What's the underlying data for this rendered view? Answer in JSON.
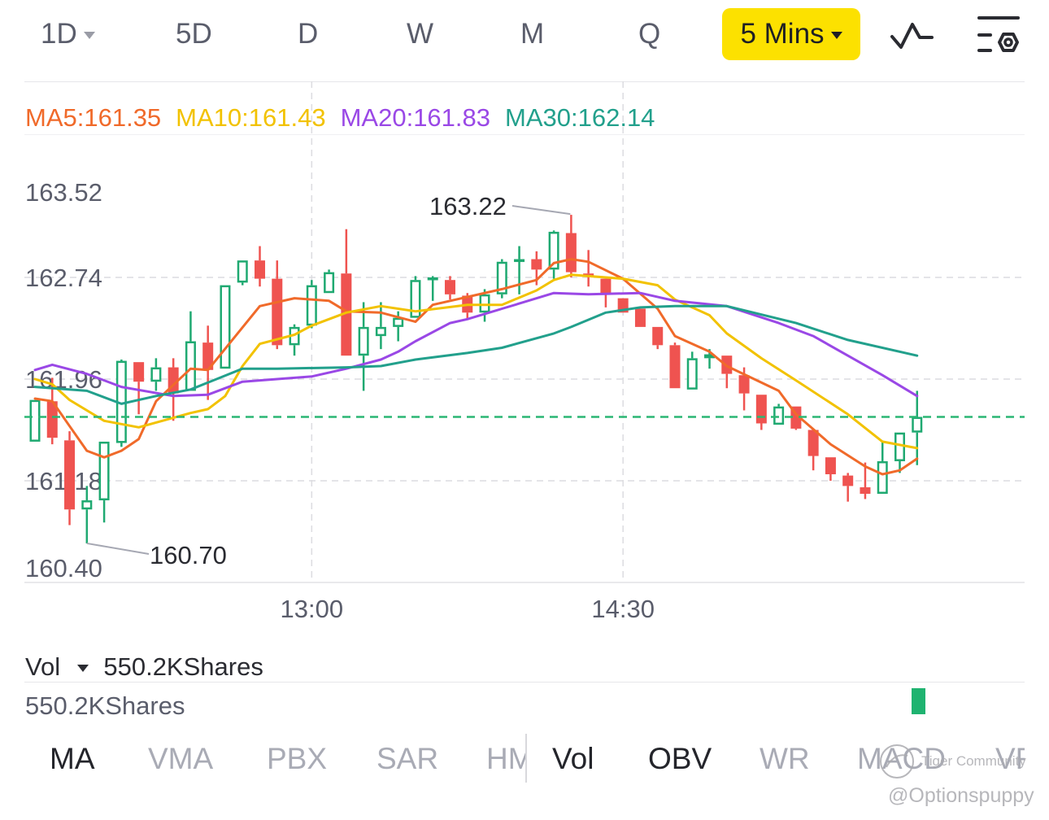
{
  "periods": [
    {
      "label": "1D",
      "dropdown": true
    },
    {
      "label": "5D"
    },
    {
      "label": "D"
    },
    {
      "label": "W"
    },
    {
      "label": "M"
    },
    {
      "label": "Q"
    }
  ],
  "interval": {
    "label": "5 Mins",
    "color": "#fce100"
  },
  "toolbar_icons": [
    "line-indicator-icon",
    "chart-settings-icon"
  ],
  "ma_legend": [
    {
      "label": "MA5:161.35",
      "color": "#f06a2a"
    },
    {
      "label": "MA10:161.43",
      "color": "#f2c200"
    },
    {
      "label": "MA20:161.83",
      "color": "#9a48e6"
    },
    {
      "label": "MA30:162.14",
      "color": "#22a08c"
    }
  ],
  "chart_data": {
    "type": "candlestick",
    "ylim": [
      160.4,
      163.52
    ],
    "y_ticks": [
      163.52,
      162.74,
      161.96,
      161.18,
      160.4
    ],
    "x_tick_labels": [
      {
        "label": "13:00",
        "bar": 16
      },
      {
        "label": "14:30",
        "bar": 34
      }
    ],
    "grid": true,
    "current_price": 161.67,
    "colors": {
      "up": "#1fa971",
      "down": "#ef5350",
      "current_line": "#2bb673"
    },
    "annotations": [
      {
        "label": "163.22",
        "bar": 31,
        "price": 163.22
      },
      {
        "label": "160.70",
        "bar": 3,
        "price": 160.7
      }
    ],
    "ohlc": [
      [
        161.48,
        161.8,
        161.48,
        161.8
      ],
      [
        161.79,
        161.97,
        161.46,
        161.51
      ],
      [
        161.49,
        161.56,
        160.84,
        160.96
      ],
      [
        160.96,
        161.14,
        160.7,
        161.03
      ],
      [
        161.03,
        161.48,
        160.86,
        161.48
      ],
      [
        161.47,
        162.11,
        161.44,
        162.1
      ],
      [
        162.09,
        162.09,
        161.69,
        161.94
      ],
      [
        161.94,
        162.12,
        161.87,
        162.05
      ],
      [
        162.05,
        162.12,
        161.64,
        161.85
      ],
      [
        161.87,
        162.48,
        161.87,
        162.25
      ],
      [
        162.24,
        162.37,
        161.8,
        162.03
      ],
      [
        162.04,
        162.68,
        162.04,
        162.68
      ],
      [
        162.7,
        162.87,
        162.68,
        162.87
      ],
      [
        162.87,
        162.98,
        162.67,
        162.73
      ],
      [
        162.73,
        162.87,
        162.19,
        162.22
      ],
      [
        162.22,
        162.38,
        162.14,
        162.36
      ],
      [
        162.37,
        162.72,
        162.35,
        162.68
      ],
      [
        162.62,
        162.8,
        162.62,
        162.78
      ],
      [
        162.77,
        163.11,
        162.14,
        162.14
      ],
      [
        162.14,
        162.55,
        161.87,
        162.36
      ],
      [
        162.29,
        162.55,
        162.19,
        162.36
      ],
      [
        162.36,
        162.48,
        162.25,
        162.43
      ],
      [
        162.43,
        162.75,
        162.43,
        162.72
      ],
      [
        162.72,
        162.75,
        162.56,
        162.74
      ],
      [
        162.72,
        162.75,
        162.57,
        162.61
      ],
      [
        162.6,
        162.62,
        162.42,
        162.47
      ],
      [
        162.47,
        162.65,
        162.4,
        162.61
      ],
      [
        162.61,
        162.88,
        162.58,
        162.86
      ],
      [
        162.86,
        162.98,
        162.61,
        162.88
      ],
      [
        162.88,
        162.94,
        162.68,
        162.8
      ],
      [
        162.8,
        163.1,
        162.73,
        163.09
      ],
      [
        163.08,
        163.22,
        162.74,
        162.78
      ],
      [
        162.77,
        162.95,
        162.67,
        162.75
      ],
      [
        162.73,
        162.73,
        162.51,
        162.61
      ],
      [
        162.58,
        162.58,
        162.47,
        162.47
      ],
      [
        162.5,
        162.5,
        162.36,
        162.36
      ],
      [
        162.36,
        162.36,
        162.19,
        162.22
      ],
      [
        162.22,
        162.24,
        161.89,
        161.89
      ],
      [
        161.88,
        162.17,
        161.88,
        162.12
      ],
      [
        162.12,
        162.19,
        162.04,
        162.15
      ],
      [
        162.14,
        162.14,
        161.89,
        162.0
      ],
      [
        161.99,
        162.05,
        161.72,
        161.85
      ],
      [
        161.84,
        161.84,
        161.57,
        161.62
      ],
      [
        161.61,
        161.77,
        161.61,
        161.75
      ],
      [
        161.75,
        161.75,
        161.57,
        161.58
      ],
      [
        161.57,
        161.57,
        161.26,
        161.37
      ],
      [
        161.36,
        161.36,
        161.18,
        161.23
      ],
      [
        161.22,
        161.24,
        161.02,
        161.14
      ],
      [
        161.13,
        161.32,
        161.04,
        161.08
      ],
      [
        161.08,
        161.48,
        161.08,
        161.33
      ],
      [
        161.33,
        161.55,
        161.24,
        161.55
      ],
      [
        161.55,
        161.87,
        161.3,
        161.67
      ]
    ],
    "ma_series": [
      {
        "name": "MA5",
        "color": "#f06a2a",
        "points": [
          [
            0,
            161.81
          ],
          [
            1,
            161.79
          ],
          [
            2,
            161.6
          ],
          [
            3,
            161.41
          ],
          [
            4,
            161.36
          ],
          [
            5,
            161.41
          ],
          [
            6,
            161.5
          ],
          [
            7,
            161.79
          ],
          [
            9,
            162.04
          ],
          [
            10,
            162.03
          ],
          [
            13,
            162.52
          ],
          [
            15,
            162.58
          ],
          [
            17,
            162.56
          ],
          [
            18,
            162.48
          ],
          [
            20,
            162.47
          ],
          [
            22,
            162.4
          ],
          [
            23,
            162.53
          ],
          [
            27,
            162.65
          ],
          [
            29,
            162.72
          ],
          [
            30,
            162.85
          ],
          [
            31,
            162.88
          ],
          [
            32,
            162.86
          ],
          [
            34,
            162.73
          ],
          [
            36,
            162.5
          ],
          [
            37,
            162.29
          ],
          [
            39,
            162.17
          ],
          [
            40,
            162.06
          ],
          [
            43,
            161.87
          ],
          [
            44,
            161.69
          ],
          [
            46,
            161.46
          ],
          [
            48,
            161.29
          ],
          [
            49,
            161.23
          ],
          [
            50,
            161.26
          ],
          [
            51,
            161.35
          ]
        ]
      },
      {
        "name": "MA10",
        "color": "#f2c200",
        "points": [
          [
            0,
            161.96
          ],
          [
            1,
            161.92
          ],
          [
            2,
            161.8
          ],
          [
            4,
            161.64
          ],
          [
            6,
            161.59
          ],
          [
            9,
            161.7
          ],
          [
            10,
            161.73
          ],
          [
            11,
            161.83
          ],
          [
            12,
            162.06
          ],
          [
            13,
            162.23
          ],
          [
            15,
            162.3
          ],
          [
            16,
            162.37
          ],
          [
            18,
            162.47
          ],
          [
            20,
            162.52
          ],
          [
            22,
            162.48
          ],
          [
            25,
            162.53
          ],
          [
            27,
            162.53
          ],
          [
            29,
            162.64
          ],
          [
            30,
            162.72
          ],
          [
            31,
            162.76
          ],
          [
            34,
            162.73
          ],
          [
            36,
            162.68
          ],
          [
            37,
            162.57
          ],
          [
            39,
            162.45
          ],
          [
            40,
            162.31
          ],
          [
            42,
            162.12
          ],
          [
            44,
            161.95
          ],
          [
            47,
            161.69
          ],
          [
            49,
            161.48
          ],
          [
            51,
            161.43
          ]
        ]
      },
      {
        "name": "MA20",
        "color": "#9a48e6",
        "points": [
          [
            0,
            162.03
          ],
          [
            1,
            162.07
          ],
          [
            3,
            162.0
          ],
          [
            5,
            161.9
          ],
          [
            8,
            161.83
          ],
          [
            10,
            161.84
          ],
          [
            12,
            161.94
          ],
          [
            14,
            161.96
          ],
          [
            16,
            161.98
          ],
          [
            18,
            162.04
          ],
          [
            20,
            162.11
          ],
          [
            21,
            162.17
          ],
          [
            22,
            162.25
          ],
          [
            24,
            162.39
          ],
          [
            25,
            162.42
          ],
          [
            27,
            162.5
          ],
          [
            28,
            162.54
          ],
          [
            30,
            162.62
          ],
          [
            32,
            162.61
          ],
          [
            35,
            162.62
          ],
          [
            37,
            162.56
          ],
          [
            40,
            162.52
          ],
          [
            43,
            162.39
          ],
          [
            45,
            162.29
          ],
          [
            47,
            162.14
          ],
          [
            49,
            161.99
          ],
          [
            51,
            161.83
          ]
        ]
      },
      {
        "name": "MA30",
        "color": "#22a08c",
        "points": [
          [
            0,
            161.9
          ],
          [
            3,
            161.87
          ],
          [
            5,
            161.77
          ],
          [
            7,
            161.83
          ],
          [
            9,
            161.88
          ],
          [
            12,
            162.04
          ],
          [
            14,
            162.04
          ],
          [
            18,
            162.05
          ],
          [
            20,
            162.06
          ],
          [
            22,
            162.11
          ],
          [
            25,
            162.16
          ],
          [
            27,
            162.2
          ],
          [
            30,
            162.31
          ],
          [
            31,
            162.36
          ],
          [
            33,
            162.47
          ],
          [
            35,
            162.51
          ],
          [
            37,
            162.52
          ],
          [
            40,
            162.52
          ],
          [
            44,
            162.39
          ],
          [
            47,
            162.26
          ],
          [
            51,
            162.14
          ]
        ]
      }
    ],
    "volume": {
      "label": "Vol",
      "value_label": "550.2KShares",
      "axis_label": "550.2KShares",
      "last_bar_direction": "up"
    }
  },
  "indicator_tabs": [
    {
      "label": "MA",
      "active": true
    },
    {
      "label": "VMA"
    },
    {
      "label": "PBX"
    },
    {
      "label": "SAR"
    },
    {
      "label": "HMA"
    },
    {
      "label": "Vol",
      "active": true
    },
    {
      "label": "OBV",
      "active": true
    },
    {
      "label": "WR"
    },
    {
      "label": "MACD"
    },
    {
      "label": "VR"
    }
  ],
  "watermark": {
    "brand": "Tiger Community",
    "user": "@Optionspuppy"
  }
}
